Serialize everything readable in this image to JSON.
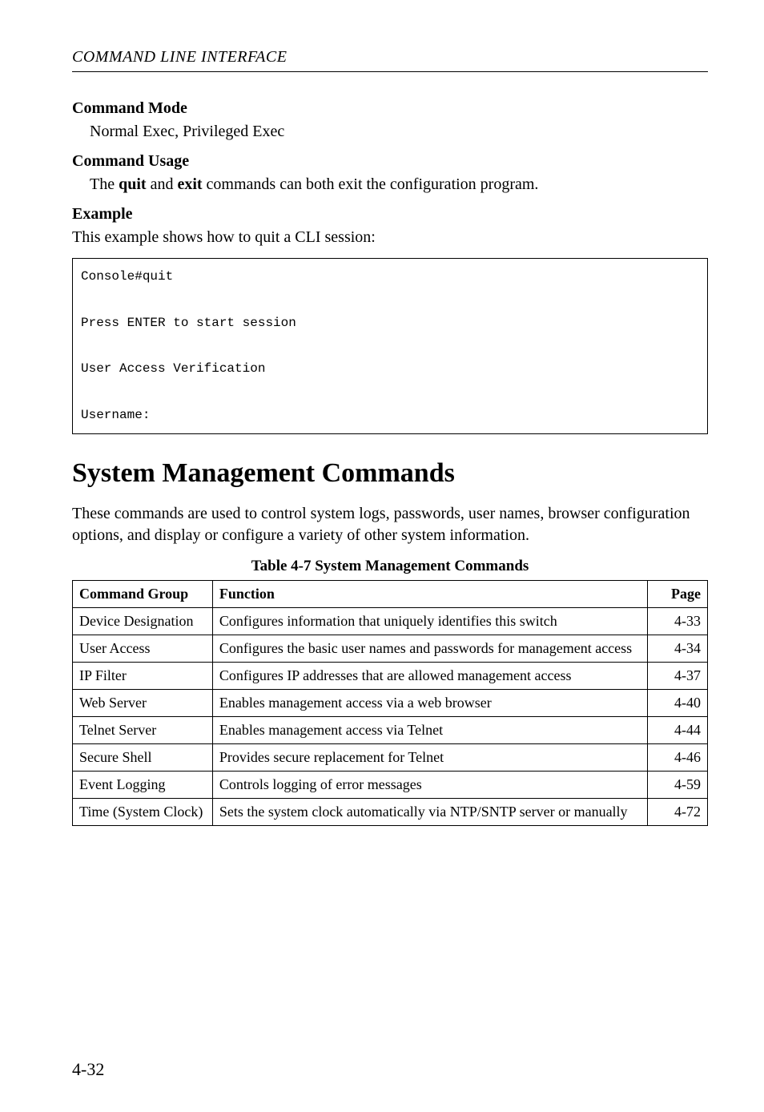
{
  "running_head": "COMMAND LINE INTERFACE",
  "sections": {
    "command_mode": {
      "heading": "Command Mode",
      "text": "Normal Exec, Privileged Exec"
    },
    "command_usage": {
      "heading": "Command Usage",
      "prefix": "The ",
      "bold1": "quit",
      "mid": " and ",
      "bold2": "exit",
      "suffix": " commands can both exit the configuration program."
    },
    "example": {
      "heading": "Example",
      "text": "This example shows how to quit a CLI session:"
    }
  },
  "code_block": "Console#quit\n\nPress ENTER to start session\n\nUser Access Verification\n\nUsername:",
  "main_heading": "System Management Commands",
  "intro_paragraph": "These commands are used to control system logs, passwords, user names, browser configuration options, and display or configure a variety of other system information.",
  "table": {
    "caption": "Table 4-7  System Management Commands",
    "headers": {
      "col1": "Command Group",
      "col2": "Function",
      "col3": "Page"
    },
    "rows": [
      {
        "group": "Device Designation",
        "function": "Configures information that uniquely identifies this switch",
        "page": "4-33"
      },
      {
        "group": "User Access",
        "function": "Configures the basic user names and passwords for management access",
        "page": "4-34"
      },
      {
        "group": "IP Filter",
        "function": "Configures IP addresses that are allowed management access",
        "page": "4-37"
      },
      {
        "group": "Web Server",
        "function": "Enables management access via a web browser",
        "page": "4-40"
      },
      {
        "group": "Telnet Server",
        "function": "Enables management access via Telnet",
        "page": "4-44"
      },
      {
        "group": "Secure Shell",
        "function": "Provides secure replacement for Telnet",
        "page": "4-46"
      },
      {
        "group": "Event Logging",
        "function": "Controls logging of error messages",
        "page": "4-59"
      },
      {
        "group": "Time (System Clock)",
        "function": "Sets the system clock automatically via NTP/SNTP server or manually",
        "page": "4-72"
      }
    ]
  },
  "page_number": "4-32"
}
